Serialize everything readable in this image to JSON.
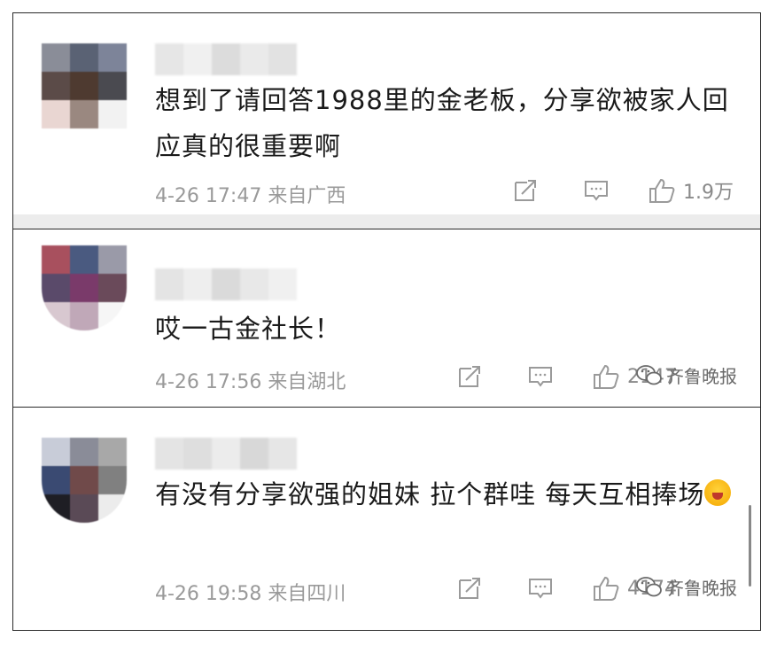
{
  "comments": [
    {
      "text": "想到了请回答1988里的金老板，分享欲被家人回应真的很重要啊",
      "time": "4-26 17:47",
      "location": "来自广西",
      "like_count": "1.9万"
    },
    {
      "text": "哎一古金社长！",
      "time": "4-26 17:56",
      "location": "来自湖北",
      "like_count": "2147"
    },
    {
      "text": "有没有分享欲强的姐妹 拉个群哇 每天互相捧场",
      "time": "4-26 19:58",
      "location": "来自四川",
      "like_count": "4174"
    }
  ],
  "watermark": {
    "text": "齐鲁晚报"
  },
  "icons": {
    "share": "share-icon",
    "comment": "comment-icon",
    "like": "thumbs-up-icon",
    "watermark": "wechat-icon",
    "emoji": "crying-face-emoji"
  }
}
